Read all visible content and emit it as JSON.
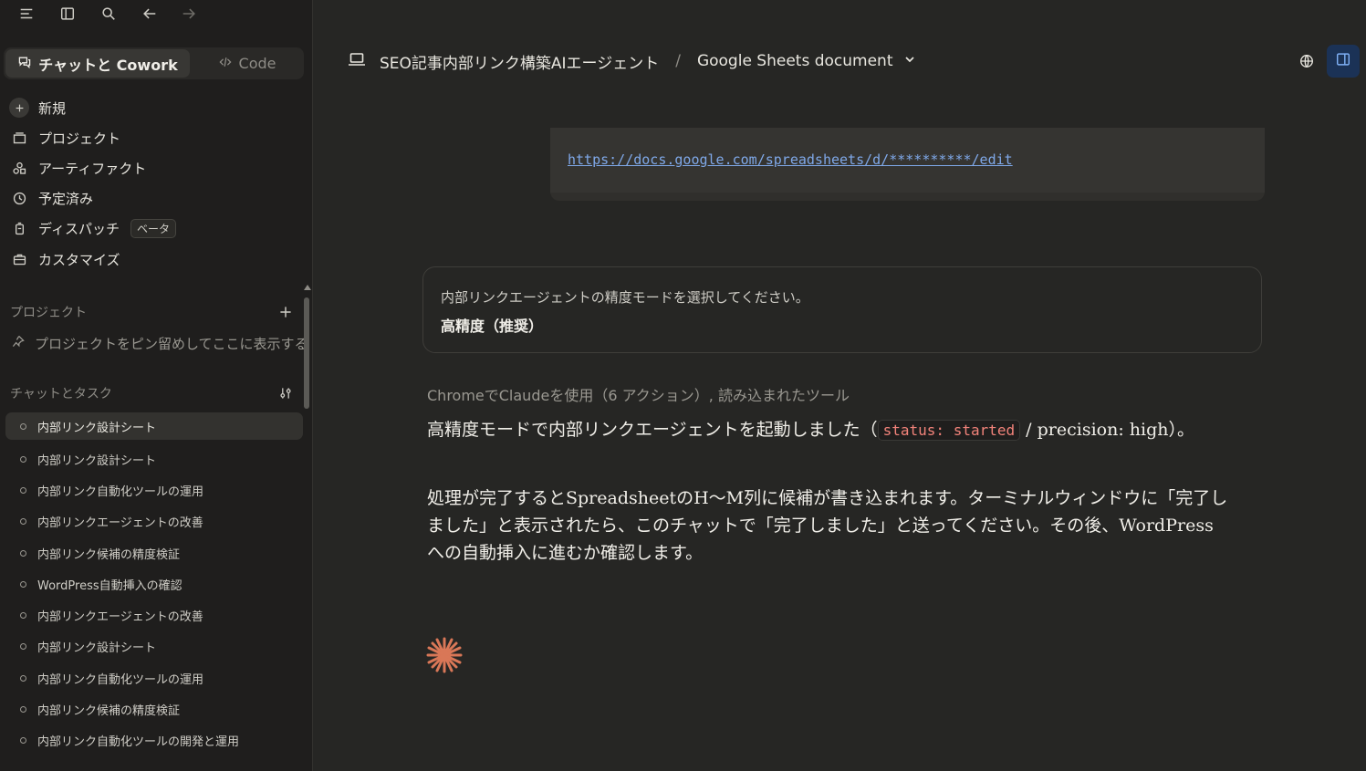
{
  "sidebar": {
    "mode_chat": "チャットと Cowork",
    "mode_code": "Code",
    "nav": [
      {
        "label": "新規",
        "icon": "plus-icon"
      },
      {
        "label": "プロジェクト",
        "icon": "folder-icon"
      },
      {
        "label": "アーティファクト",
        "icon": "artifacts-icon"
      },
      {
        "label": "予定済み",
        "icon": "clock-icon"
      },
      {
        "label": "ディスパッチ",
        "icon": "dispatch-icon",
        "badge": "ベータ"
      },
      {
        "label": "カスタマイズ",
        "icon": "briefcase-icon"
      }
    ],
    "projects_title": "プロジェクト",
    "projects_hint": "プロジェクトをピン留めしてここに表示する",
    "tasks_title": "チャットとタスク",
    "tasks": [
      "内部リンク設計シート",
      "内部リンク設計シート",
      "内部リンク自動化ツールの運用",
      "内部リンクエージェントの改善",
      "内部リンク候補の精度検証",
      "WordPress自動挿入の確認",
      "内部リンクエージェントの改善",
      "内部リンク設計シート",
      "内部リンク自動化ツールの運用",
      "内部リンク候補の精度検証",
      "内部リンク自動化ツールの開発と運用"
    ]
  },
  "header": {
    "project": "SEO記事内部リンク構築AIエージェント",
    "separator": "/",
    "document": "Google Sheets document"
  },
  "code": {
    "url": "https://docs.google.com/spreadsheets/d/**********/edit"
  },
  "question": {
    "prompt": "内部リンクエージェントの精度モードを選択してください。",
    "answer": "高精度（推奨）"
  },
  "toolline": "ChromeでClaudeを使用（6 アクション）, 読み込まれたツール",
  "response": {
    "p1_before": "高精度モードで内部リンクエージェントを起動しました（",
    "p1_code": "status: started",
    "p1_after": " / precision: high）。",
    "p2": "処理が完了するとSpreadsheetのH〜M列に候補が書き込まれます。ターミナルウィンドウに「完了しました」と表示されたら、このチャットで「完了しました」と送ってください。その後、WordPressへの自動挿入に進むか確認します。"
  },
  "colors": {
    "accent_spark": "#d97757",
    "link": "#7fa8e8",
    "code_text": "#f2837a"
  }
}
